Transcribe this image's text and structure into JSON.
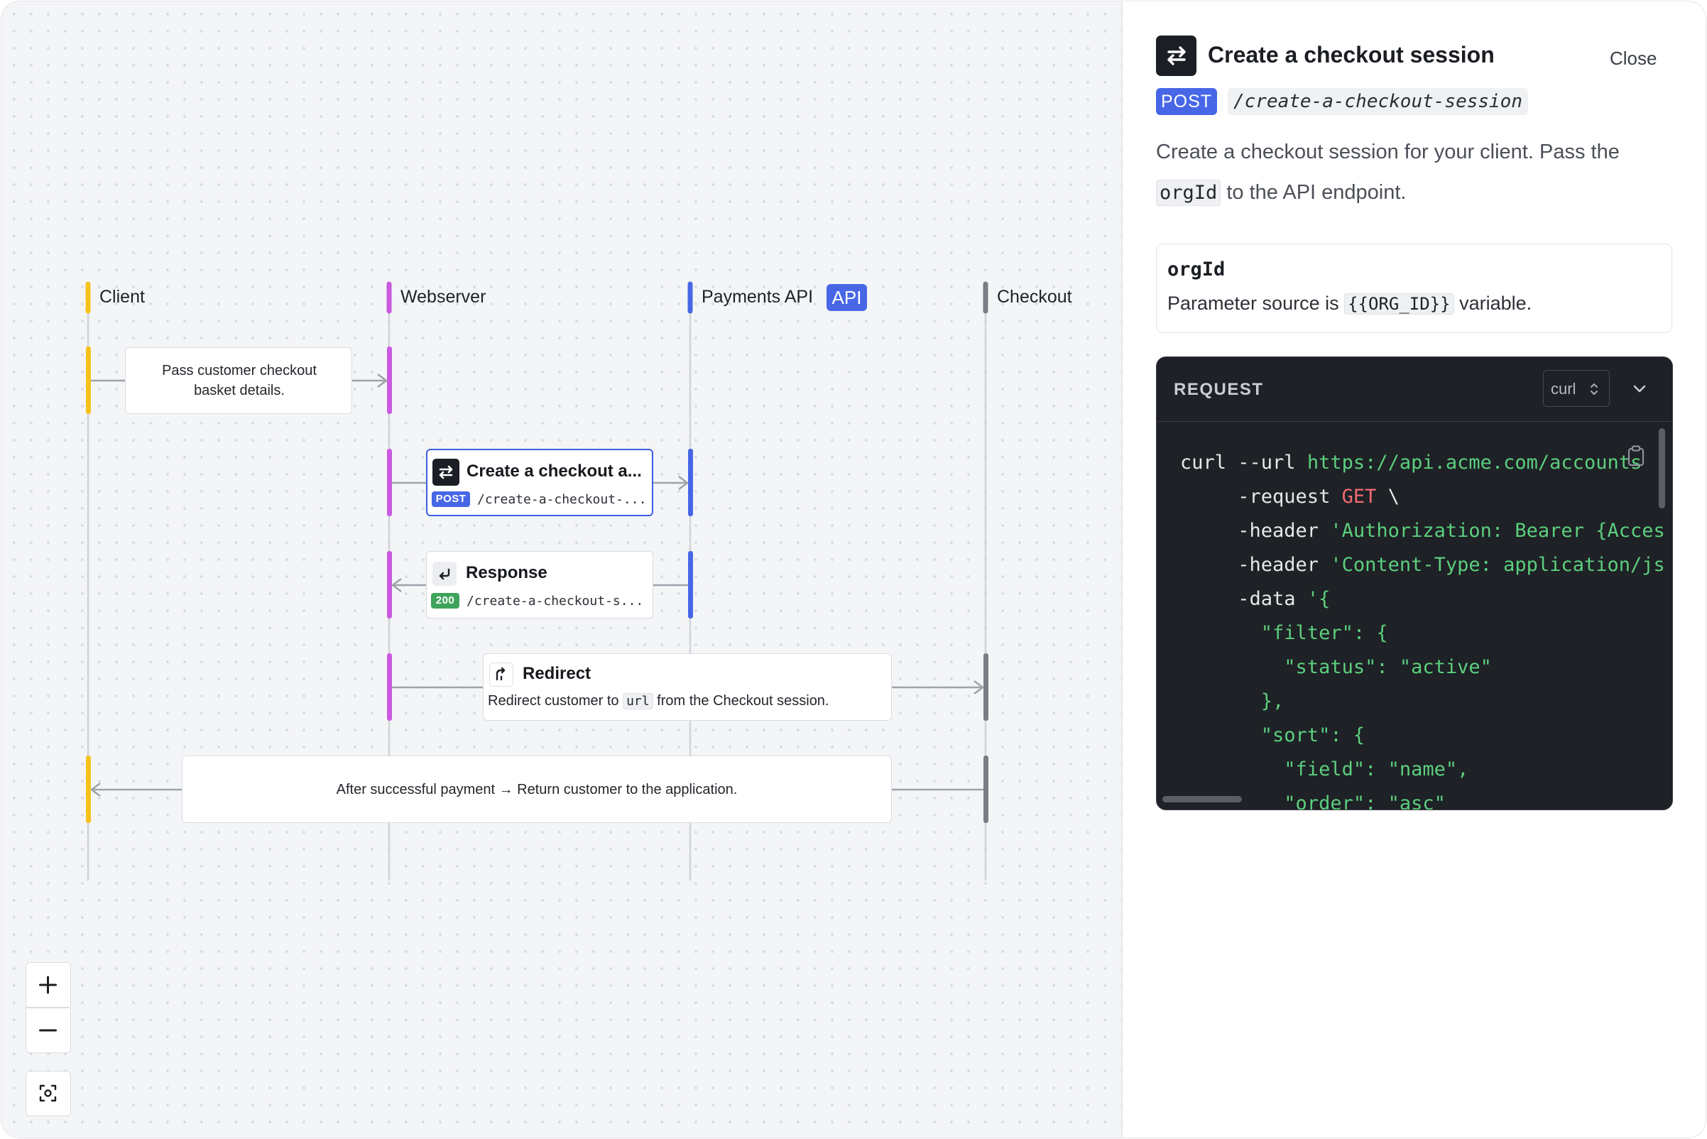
{
  "diagram": {
    "lanes": [
      {
        "name": "Client",
        "color": "#f5c21b"
      },
      {
        "name": "Webserver",
        "color": "#c95ae0"
      },
      {
        "name": "Payments API",
        "color": "#4867e6",
        "tag": "API"
      },
      {
        "name": "Checkout",
        "color": "#7a7d83"
      }
    ],
    "steps": {
      "basket": {
        "text": "Pass customer checkout basket details."
      },
      "create": {
        "title": "Create a checkout a...",
        "method": "POST",
        "path": "/create-a-checkout-..."
      },
      "response": {
        "title": "Response",
        "status": "200",
        "path": "/create-a-checkout-s..."
      },
      "redirect": {
        "title": "Redirect",
        "text_before": "Redirect customer to",
        "code": "url",
        "text_after": "from the Checkout session."
      },
      "return": {
        "text": "After successful payment → Return customer to the application."
      }
    },
    "colors": {
      "post": "#4867e6",
      "ok": "#3fa45b",
      "selected": "#3c5fe0"
    }
  },
  "controls": {
    "zoom_in": "plus-icon",
    "zoom_out": "minus-icon",
    "fit": "fit-view-icon"
  },
  "panel": {
    "title": "Create a checkout session",
    "close_label": "Close",
    "method": "POST",
    "path": "/create-a-checkout-session",
    "description_before": "Create a checkout session for your client. Pass the",
    "description_code": "orgId",
    "description_after": "to the API endpoint.",
    "param": {
      "name": "orgId",
      "source_before": "Parameter source is",
      "source_code": "{{ORG_ID}}",
      "source_after": "variable."
    },
    "request": {
      "heading": "REQUEST",
      "language": "curl",
      "lines": [
        [
          {
            "t": "curl --url "
          },
          {
            "t": "https://api.acme.com/accounts",
            "c": "str"
          }
        ],
        [
          {
            "t": "     -request "
          },
          {
            "t": "GET",
            "c": "kw"
          },
          {
            "t": " \\"
          }
        ],
        [
          {
            "t": "     -header "
          },
          {
            "t": "'Authorization: Bearer {Acces",
            "c": "str"
          }
        ],
        [
          {
            "t": "     -header "
          },
          {
            "t": "'Content-Type: application/js",
            "c": "str"
          }
        ],
        [
          {
            "t": "     -data "
          },
          {
            "t": "'{",
            "c": "str"
          }
        ],
        [
          {
            "t": "       \"filter\": {",
            "c": "str"
          }
        ],
        [
          {
            "t": "         \"status\": \"active\"",
            "c": "str"
          }
        ],
        [
          {
            "t": "       },",
            "c": "str"
          }
        ],
        [
          {
            "t": "       \"sort\": {",
            "c": "str"
          }
        ],
        [
          {
            "t": "         \"field\": \"name\",",
            "c": "str"
          }
        ],
        [
          {
            "t": "         \"order\": \"asc\"",
            "c": "str"
          }
        ]
      ]
    }
  }
}
